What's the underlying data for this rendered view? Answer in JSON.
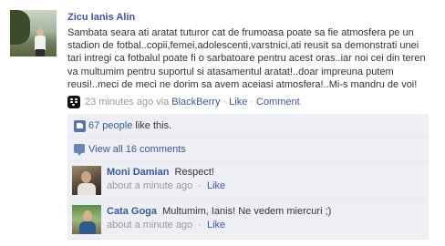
{
  "post": {
    "author": "Zicu Ianis Alin",
    "message": "Sambata seara ati aratat tuturor cat de frumoasa poate sa fie atmosfera pe un stadion de fotbal..copii,femei,adolescenti,varstnici,ati reusit sa demonstrati unei tari intregi ca fotbalul poate fi o sarbatoare pentru acest oras..iar noi cei din teren va multumim pentru suportul si atasamentul aratat!..doar impreuna putem reusi!..meci de meci ne dorim sa avem aceiasi atmosfera!..Mi-s mandru de voi!",
    "time": "23 minutes ago",
    "via": "via",
    "source": "BlackBerry",
    "like_label": "Like",
    "comment_label": "Comment",
    "separator": "·",
    "source_icon": "blackberry-icon"
  },
  "likes": {
    "count_text": "67 people",
    "suffix": "like this.",
    "icon": "thumbs-up-icon"
  },
  "view_comments": {
    "label": "View all 16 comments",
    "icon": "comment-bubble-icon"
  },
  "comments": [
    {
      "author": "Moni Damian",
      "text": "Respect!",
      "time": "about a minute ago",
      "like_label": "Like"
    },
    {
      "author": "Cata Goga",
      "text": "Multumim, Ianis! Ne vedem miercuri ;)",
      "time": "about a minute ago",
      "like_label": "Like"
    }
  ],
  "colors": {
    "link": "#3b5998",
    "muted": "#999999",
    "ufi_background": "#edeff4"
  }
}
